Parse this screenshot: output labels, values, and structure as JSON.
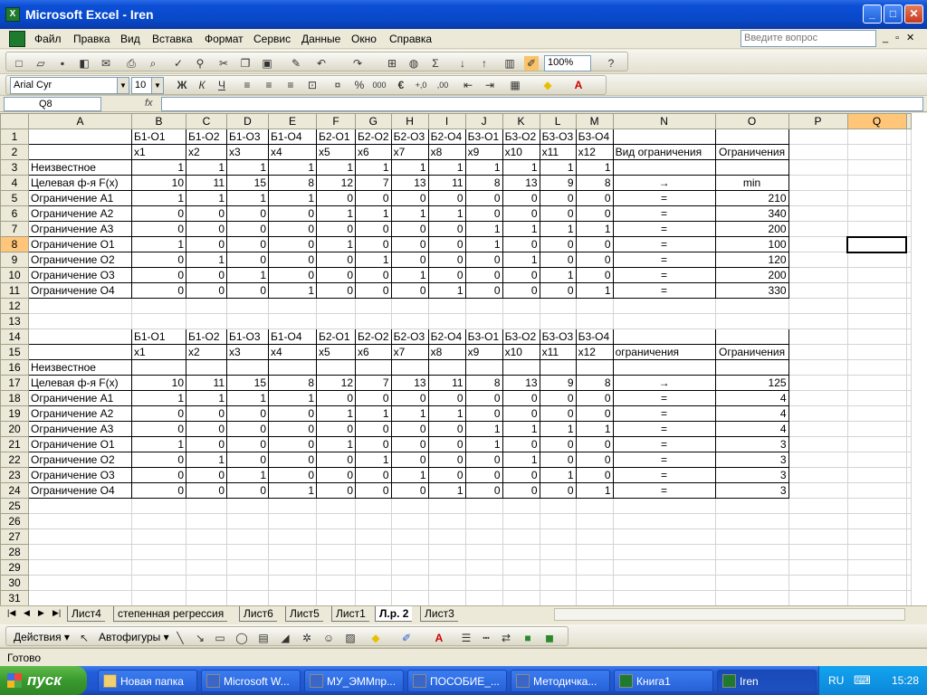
{
  "window": {
    "title": "Microsoft Excel - Iren",
    "min": "_",
    "max": "□",
    "close": "✕"
  },
  "menu": {
    "items": [
      "Файл",
      "Правка",
      "Вид",
      "Вставка",
      "Формат",
      "Сервис",
      "Данные",
      "Окно",
      "Справка"
    ],
    "ask_placeholder": "Введите вопрос"
  },
  "toolbar": {
    "zoom": "100%"
  },
  "format": {
    "font": "Arial Cyr",
    "size": "10"
  },
  "formula": {
    "cell": "Q8",
    "fx": "fx",
    "value": ""
  },
  "columns": [
    "A",
    "B",
    "C",
    "D",
    "E",
    "F",
    "G",
    "H",
    "I",
    "J",
    "K",
    "L",
    "M",
    "N",
    "O",
    "P",
    "Q"
  ],
  "selected": {
    "col": "Q",
    "row": 8
  },
  "rows": [
    [
      "",
      "Б1-О1",
      "Б1-О2",
      "Б1-О3",
      "Б1-О4",
      "Б2-О1",
      "Б2-О2",
      "Б2-О3",
      "Б2-О4",
      "Б3-О1",
      "Б3-О2",
      "Б3-О3",
      "Б3-О4",
      "",
      ""
    ],
    [
      "",
      "x1",
      "x2",
      "x3",
      "x4",
      "x5",
      "x6",
      "x7",
      "x8",
      "x9",
      "x10",
      "x11",
      "x12",
      "Вид ограничения",
      "Ограничения"
    ],
    [
      "Неизвестное",
      "1",
      "1",
      "1",
      "1",
      "1",
      "1",
      "1",
      "1",
      "1",
      "1",
      "1",
      "1",
      "",
      ""
    ],
    [
      "Целевая ф-я F(x)",
      "10",
      "11",
      "15",
      "8",
      "12",
      "7",
      "13",
      "11",
      "8",
      "13",
      "9",
      "8",
      "→",
      "min"
    ],
    [
      "Ограничение А1",
      "1",
      "1",
      "1",
      "1",
      "0",
      "0",
      "0",
      "0",
      "0",
      "0",
      "0",
      "0",
      "=",
      "210"
    ],
    [
      "Ограничение А2",
      "0",
      "0",
      "0",
      "0",
      "1",
      "1",
      "1",
      "1",
      "0",
      "0",
      "0",
      "0",
      "=",
      "340"
    ],
    [
      "Ограничение А3",
      "0",
      "0",
      "0",
      "0",
      "0",
      "0",
      "0",
      "0",
      "1",
      "1",
      "1",
      "1",
      "=",
      "200"
    ],
    [
      "Ограничение О1",
      "1",
      "0",
      "0",
      "0",
      "1",
      "0",
      "0",
      "0",
      "1",
      "0",
      "0",
      "0",
      "=",
      "100"
    ],
    [
      "Ограничение О2",
      "0",
      "1",
      "0",
      "0",
      "0",
      "1",
      "0",
      "0",
      "0",
      "1",
      "0",
      "0",
      "=",
      "120"
    ],
    [
      "Ограничение О3",
      "0",
      "0",
      "1",
      "0",
      "0",
      "0",
      "1",
      "0",
      "0",
      "0",
      "1",
      "0",
      "=",
      "200"
    ],
    [
      "Ограничение О4",
      "0",
      "0",
      "0",
      "1",
      "0",
      "0",
      "0",
      "1",
      "0",
      "0",
      "0",
      "1",
      "=",
      "330"
    ],
    [
      "",
      "",
      "",
      "",
      "",
      "",
      "",
      "",
      "",
      "",
      "",
      "",
      "",
      "",
      ""
    ],
    [
      "",
      "",
      "",
      "",
      "",
      "",
      "",
      "",
      "",
      "",
      "",
      "",
      "",
      "",
      ""
    ],
    [
      "",
      "Б1-О1",
      "Б1-О2",
      "Б1-О3",
      "Б1-О4",
      "Б2-О1",
      "Б2-О2",
      "Б2-О3",
      "Б2-О4",
      "Б3-О1",
      "Б3-О2",
      "Б3-О3",
      "Б3-О4",
      "",
      ""
    ],
    [
      "",
      "x1",
      "x2",
      "x3",
      "x4",
      "x5",
      "x6",
      "x7",
      "x8",
      "x9",
      "x10",
      "x11",
      "x12",
      "ограничения",
      "Ограничения"
    ],
    [
      "Неизвестное",
      "",
      "",
      "",
      "",
      "",
      "",
      "",
      "",
      "",
      "",
      "",
      "",
      "",
      ""
    ],
    [
      "Целевая ф-я F(x)",
      "10",
      "11",
      "15",
      "8",
      "12",
      "7",
      "13",
      "11",
      "8",
      "13",
      "9",
      "8",
      "→",
      "125"
    ],
    [
      "Ограничение А1",
      "1",
      "1",
      "1",
      "1",
      "0",
      "0",
      "0",
      "0",
      "0",
      "0",
      "0",
      "0",
      "=",
      "4"
    ],
    [
      "Ограничение А2",
      "0",
      "0",
      "0",
      "0",
      "1",
      "1",
      "1",
      "1",
      "0",
      "0",
      "0",
      "0",
      "=",
      "4"
    ],
    [
      "Ограничение А3",
      "0",
      "0",
      "0",
      "0",
      "0",
      "0",
      "0",
      "0",
      "1",
      "1",
      "1",
      "1",
      "=",
      "4"
    ],
    [
      "Ограничение О1",
      "1",
      "0",
      "0",
      "0",
      "1",
      "0",
      "0",
      "0",
      "1",
      "0",
      "0",
      "0",
      "=",
      "3"
    ],
    [
      "Ограничение О2",
      "0",
      "1",
      "0",
      "0",
      "0",
      "1",
      "0",
      "0",
      "0",
      "1",
      "0",
      "0",
      "=",
      "3"
    ],
    [
      "Ограничение О3",
      "0",
      "0",
      "1",
      "0",
      "0",
      "0",
      "1",
      "0",
      "0",
      "0",
      "1",
      "0",
      "=",
      "3"
    ],
    [
      "Ограничение О4",
      "0",
      "0",
      "0",
      "1",
      "0",
      "0",
      "0",
      "1",
      "0",
      "0",
      "0",
      "1",
      "=",
      "3"
    ]
  ],
  "total_rows": 31,
  "sheets": [
    "Лист4",
    "степенная регрессия",
    "Лист6",
    "Лист5",
    "Лист1",
    "Л.р. 2",
    "Лист3"
  ],
  "active_sheet": "Л.р. 2",
  "drawing": {
    "actions": "Действия ▾",
    "autoshapes": "Автофигуры ▾"
  },
  "status": "Готово",
  "taskbar": {
    "start": "пуск",
    "tasks": [
      "Новая папка",
      "Microsoft W...",
      "МУ_ЭММпр...",
      "ПОСОБИЕ_...",
      "Методичка...",
      "Книга1",
      "Iren"
    ],
    "lang": "RU",
    "clock": "15:28"
  }
}
